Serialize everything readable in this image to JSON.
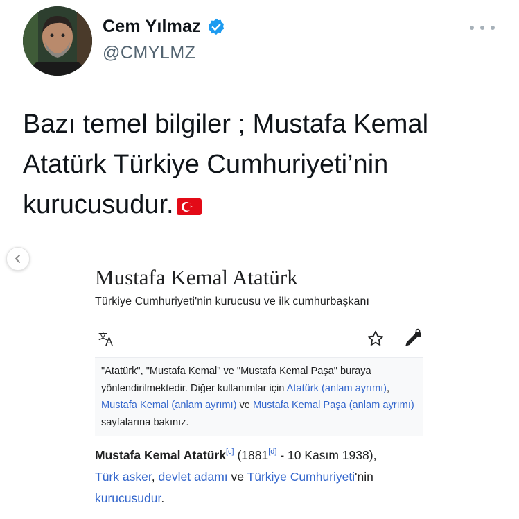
{
  "profile": {
    "name": "Cem Yılmaz",
    "handle": "@CMYLMZ",
    "verified_color": "#1d9bf0"
  },
  "more_menu": {
    "icon": "more-horizontal-icon"
  },
  "tweet": {
    "text": "Bazı temel bilgiler ; Mustafa Kemal Atatürk Türkiye Cumhuriyeti’nin kurucusudur.",
    "emoji": "turkey-flag-icon"
  },
  "carousel": {
    "prev_icon": "chevron-left-icon"
  },
  "wiki": {
    "title": "Mustafa Kemal Atatürk",
    "subtitle": "Türkiye Cumhuriyeti'nin kurucusu ve ilk cumhurbaşkanı",
    "toolbar": {
      "language_icon": "language-icon",
      "watch_icon": "star-icon",
      "edit_icon": "edit-lock-icon"
    },
    "hatnote": {
      "p1": "\"Atatürk\", \"Mustafa Kemal\" ve \"Mustafa Kemal Paşa\" buraya yönlendirilmektedir. Diğer kullanımlar için ",
      "link1": "Atatürk (anlam ayrımı)",
      "sep1": ", ",
      "link2": "Mustafa Kemal (anlam ayrımı)",
      "sep2": " ve ",
      "link3": "Mustafa Kemal Paşa (anlam ayrımı)",
      "p2": " sayfalarına bakınız."
    },
    "lead": {
      "bold": "Mustafa Kemal Atatürk",
      "ref_c": "[c]",
      "t1": " (1881",
      "ref_d": "[d]",
      "t2": " - 10 Kasım 1938),",
      "link1": "Türk asker",
      "t3": ", ",
      "link2": "devlet adamı",
      "t4": " ve ",
      "link3": "Türkiye Cumhuriyeti",
      "t5": "'nin",
      "link4": "kurucusudur",
      "t6": "."
    },
    "link_color": "#3366cc"
  }
}
